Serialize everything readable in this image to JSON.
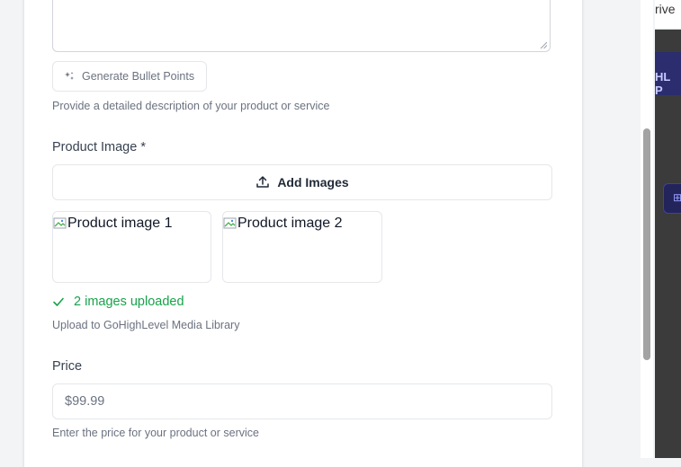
{
  "description_field": {
    "generate_label": "Generate Bullet Points",
    "helper": "Provide a detailed description of your product or service"
  },
  "product_image": {
    "label": "Product Image *",
    "add_label": "Add Images",
    "images": [
      {
        "alt": "Product image 1"
      },
      {
        "alt": "Product image 2"
      }
    ],
    "status": "2 images uploaded",
    "helper": "Upload to GoHighLevel Media Library"
  },
  "price": {
    "label": "Price",
    "placeholder": "$99.99",
    "helper": "Enter the price for your product or service"
  },
  "background_app": {
    "top_text": "rive",
    "band_text": "HL P",
    "chip_text": "⊞"
  },
  "colors": {
    "success": "#16a34a",
    "muted_text": "#6b7280",
    "border": "#e5e7eb",
    "background_band": "#2b2d6e"
  }
}
